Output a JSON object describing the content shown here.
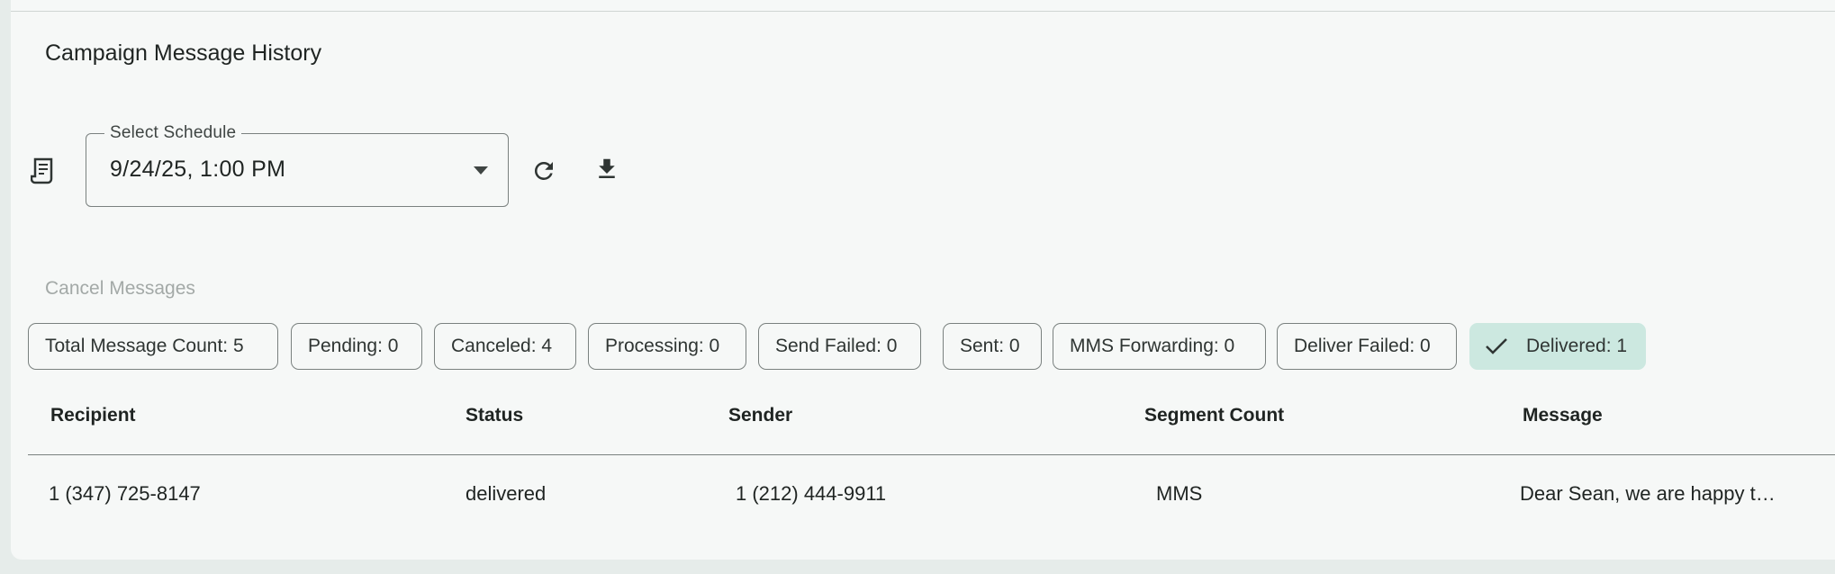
{
  "header": {
    "title": "Campaign Message History"
  },
  "schedule": {
    "label": "Select Schedule",
    "value": "9/24/25,  1:00 PM"
  },
  "actions": {
    "cancel_messages": "Cancel Messages"
  },
  "chips": [
    {
      "label": "Total Message Count: 5",
      "active": false
    },
    {
      "label": "Pending: 0",
      "active": false
    },
    {
      "label": "Canceled:  4",
      "active": false
    },
    {
      "label": "Processing: 0",
      "active": false
    },
    {
      "label": "Send Failed: 0",
      "active": false
    },
    {
      "label": "Sent: 0",
      "active": false
    },
    {
      "label": "MMS Forwarding: 0",
      "active": false
    },
    {
      "label": "Deliver Failed: 0",
      "active": false
    },
    {
      "label": "Delivered: 1",
      "active": true
    }
  ],
  "table": {
    "columns": [
      "Recipient",
      "Status",
      "Sender",
      "Segment Count",
      "Message"
    ],
    "rows": [
      {
        "recipient": "1 (347) 725-8147",
        "status": "delivered",
        "sender": "1 (212) 444-9911",
        "segment_count": "MMS",
        "message": "Dear Sean, we are happy t…"
      }
    ]
  },
  "colors": {
    "active_chip": "#cce8e0",
    "background": "#f6f8f7"
  }
}
